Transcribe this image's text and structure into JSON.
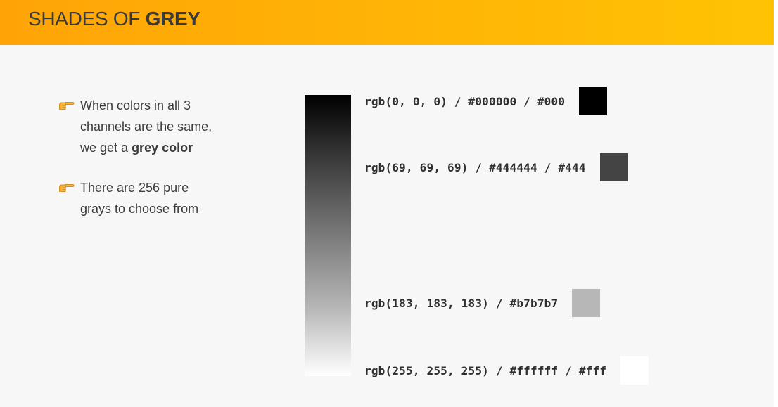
{
  "header": {
    "title_normal": "SHADES OF",
    "title_bold": "GREY",
    "accent_start": "#ffa407",
    "accent_end": "#ffc304"
  },
  "bullets": [
    {
      "icon": "pointing-hand-icon",
      "line1": "When colors in all 3",
      "line2": "channels are the same,",
      "line3_prefix": "we get a",
      "line3_bold": "grey color"
    },
    {
      "icon": "pointing-hand-icon",
      "line1": "There are 256 pure",
      "line2": "grays to choose from"
    }
  ],
  "shades": [
    {
      "label": "rgb(0, 0, 0) / #000000 / #000",
      "color": "#000000"
    },
    {
      "label": "rgb(69, 69, 69) / #444444 / #444",
      "color": "#444444"
    },
    {
      "label": "rgb(183, 183, 183) / #b7b7b7",
      "color": "#b7b7b7"
    },
    {
      "label": "rgb(255, 255, 255) / #ffffff / #fff",
      "color": "#ffffff"
    }
  ]
}
